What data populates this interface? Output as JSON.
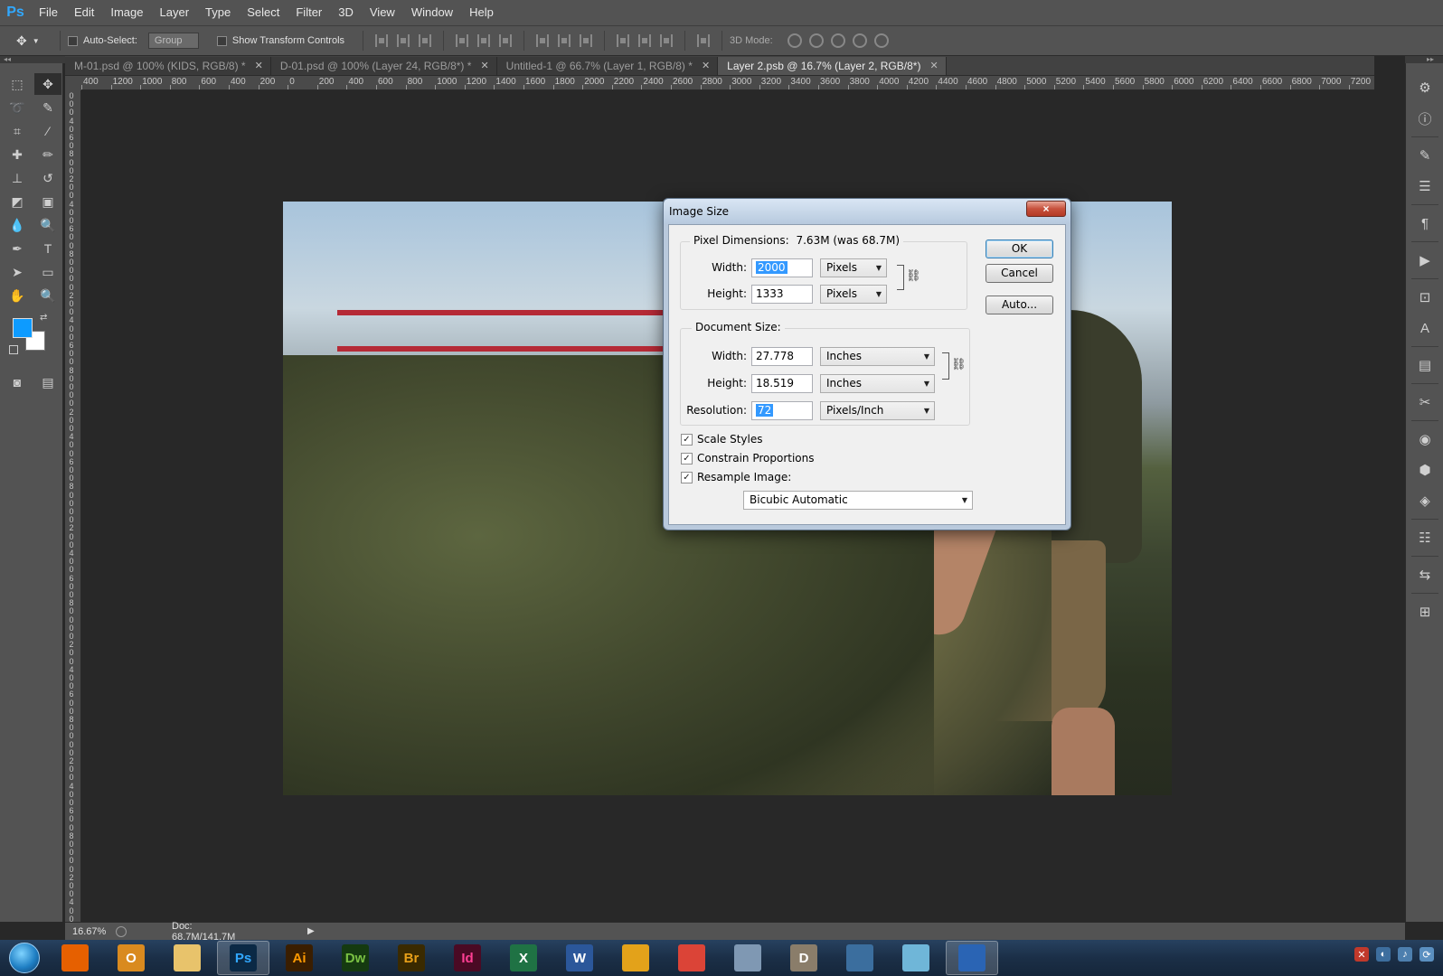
{
  "app": {
    "logo": "Ps",
    "menu": [
      "File",
      "Edit",
      "Image",
      "Layer",
      "Type",
      "Select",
      "Filter",
      "3D",
      "View",
      "Window",
      "Help"
    ]
  },
  "options_bar": {
    "auto_select_label": "Auto-Select:",
    "auto_select_value": "Group",
    "show_transform_label": "Show Transform Controls",
    "mode_label": "3D Mode:"
  },
  "tabs": [
    {
      "label": "M-01.psd @ 100% (KIDS, RGB/8) *"
    },
    {
      "label": "D-01.psd @ 100% (Layer 24, RGB/8*) *"
    },
    {
      "label": "Untitled-1 @ 66.7% (Layer 1, RGB/8) *"
    },
    {
      "label": "Layer 2.psb @ 16.7% (Layer 2, RGB/8*)"
    }
  ],
  "hruler_labels": [
    "400",
    "1200",
    "1000",
    "800",
    "600",
    "400",
    "200",
    "0",
    "200",
    "400",
    "600",
    "800",
    "1000",
    "1200",
    "1400",
    "1600",
    "1800",
    "2000",
    "2200",
    "2400",
    "2600",
    "2800",
    "3000",
    "3200",
    "3400",
    "3600",
    "3800",
    "4000",
    "4200",
    "4400",
    "4600",
    "4800",
    "5000",
    "5200",
    "5400",
    "5600",
    "5800",
    "6000",
    "6200",
    "6400",
    "6600",
    "6800",
    "7000",
    "7200"
  ],
  "status_bar": {
    "zoom": "16.67%",
    "doc": "Doc: 68.7M/141.7M"
  },
  "dialog": {
    "title": "Image Size",
    "close_glyph": "×",
    "pixel_dimensions_label": "Pixel Dimensions:",
    "pixel_dimensions_value": "7.63M (was 68.7M)",
    "px_width_label": "Width:",
    "px_width_value": "2000",
    "px_width_unit": "Pixels",
    "px_height_label": "Height:",
    "px_height_value": "1333",
    "px_height_unit": "Pixels",
    "document_size_label": "Document Size:",
    "doc_width_label": "Width:",
    "doc_width_value": "27.778",
    "doc_width_unit": "Inches",
    "doc_height_label": "Height:",
    "doc_height_value": "18.519",
    "doc_height_unit": "Inches",
    "resolution_label": "Resolution:",
    "resolution_value": "72",
    "resolution_unit": "Pixels/Inch",
    "scale_styles_label": "Scale Styles",
    "constrain_label": "Constrain Proportions",
    "resample_label": "Resample Image:",
    "resample_method": "Bicubic Automatic",
    "ok_label": "OK",
    "cancel_label": "Cancel",
    "auto_label": "Auto...",
    "scale_styles_checked": true,
    "constrain_checked": true,
    "resample_checked": true
  },
  "colors": {
    "foreground": "#0d9bff",
    "background": "#ffffff"
  },
  "taskbar": {
    "apps": [
      {
        "name": "firefox-icon",
        "glyph": "",
        "bg": "#e66000"
      },
      {
        "name": "outlook-icon",
        "glyph": "O",
        "bg": "#d98a1f"
      },
      {
        "name": "explorer-icon",
        "glyph": "",
        "bg": "#e8c36b"
      },
      {
        "name": "photoshop-icon",
        "glyph": "Ps",
        "bg": "#0b2945",
        "fg": "#31a8ff",
        "active": true
      },
      {
        "name": "illustrator-icon",
        "glyph": "Ai",
        "bg": "#3a1e00",
        "fg": "#ff9a00"
      },
      {
        "name": "dreamweaver-icon",
        "glyph": "Dw",
        "bg": "#153a10",
        "fg": "#7ac143"
      },
      {
        "name": "bridge-icon",
        "glyph": "Br",
        "bg": "#3a2a00",
        "fg": "#e8a019"
      },
      {
        "name": "indesign-icon",
        "glyph": "Id",
        "bg": "#4a0a24",
        "fg": "#ff3f94"
      },
      {
        "name": "excel-icon",
        "glyph": "X",
        "bg": "#1f7244",
        "fg": "#fff"
      },
      {
        "name": "word-icon",
        "glyph": "W",
        "bg": "#2b579a",
        "fg": "#fff"
      },
      {
        "name": "pen-tool-icon",
        "glyph": "",
        "bg": "#e3a21a"
      },
      {
        "name": "chrome-icon",
        "glyph": "",
        "bg": "#db4437"
      },
      {
        "name": "calculator-icon",
        "glyph": "",
        "bg": "#7f98b3"
      },
      {
        "name": "d-app-icon",
        "glyph": "D",
        "bg": "#8a7d6a",
        "fg": "#fff"
      },
      {
        "name": "media-icon",
        "glyph": "",
        "bg": "#3b6e9e"
      },
      {
        "name": "notes-icon",
        "glyph": "",
        "bg": "#6fb6d8"
      },
      {
        "name": "window-switcher-icon",
        "glyph": "",
        "bg": "#2a64b4",
        "active": true
      }
    ]
  }
}
